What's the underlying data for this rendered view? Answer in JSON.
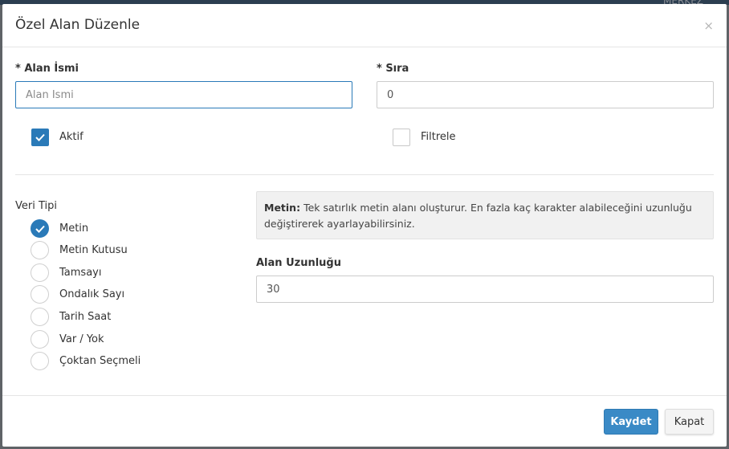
{
  "background": {
    "header_text": "MERKEZ"
  },
  "modal": {
    "title": "Özel Alan Düzenle",
    "close_glyph": "×"
  },
  "form": {
    "name_label": "* Alan İsmi",
    "name_placeholder": "Alan İsmi",
    "name_value": "",
    "order_label": "* Sıra",
    "order_value": "0",
    "active_label": "Aktif",
    "active_checked": true,
    "filter_label": "Filtrele",
    "filter_checked": false
  },
  "data_type": {
    "label": "Veri Tipi",
    "selected": "Metin",
    "options": [
      {
        "label": "Metin",
        "checked": true
      },
      {
        "label": "Metin Kutusu",
        "checked": false
      },
      {
        "label": "Tamsayı",
        "checked": false
      },
      {
        "label": "Ondalık Sayı",
        "checked": false
      },
      {
        "label": "Tarih Saat",
        "checked": false
      },
      {
        "label": "Var / Yok",
        "checked": false
      },
      {
        "label": "Çoktan Seçmeli",
        "checked": false
      }
    ]
  },
  "info": {
    "title": "Metin:",
    "text": "Tek satırlık metin alanı oluşturur. En fazla kaç karakter alabileceğini uzunluğu değiştirerek ayarlayabilirsiniz."
  },
  "length": {
    "label": "Alan Uzunluğu",
    "value": "30"
  },
  "footer": {
    "save_label": "Kaydet",
    "close_label": "Kapat"
  },
  "colors": {
    "accent": "#2a7ab8",
    "primary_button": "#3a8ac6"
  },
  "icons": {
    "close": "close-icon",
    "check": "check-icon"
  }
}
